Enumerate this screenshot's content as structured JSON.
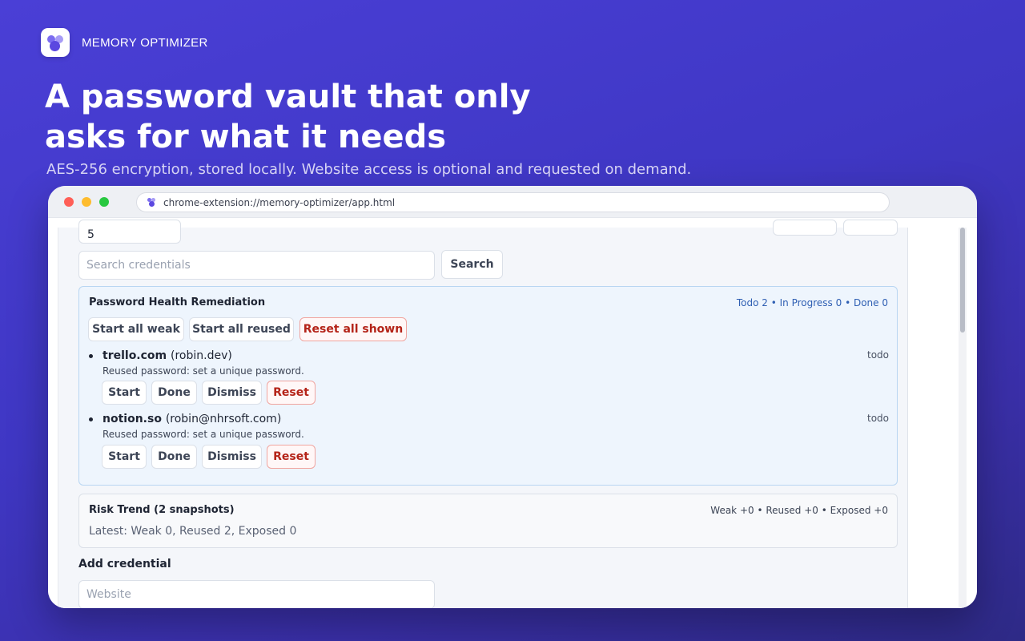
{
  "brand": {
    "name": "MEMORY OPTIMIZER",
    "logo_icon": "memory-optimizer-logo-icon"
  },
  "hero": {
    "headline_line1": "A password vault that only",
    "headline_line2": "asks for what it needs",
    "subline": "AES-256 encryption, stored locally. Website access is optional and requested on demand."
  },
  "browser": {
    "url": "chrome-extension://memory-optimizer/app.html",
    "traffic_lights": [
      "close",
      "minimize",
      "maximize"
    ]
  },
  "app": {
    "partial_field_value": "5",
    "search": {
      "placeholder": "Search credentials",
      "button_label": "Search"
    },
    "health": {
      "title": "Password Health Remediation",
      "stats": {
        "todo": "Todo 2",
        "in_progress": "In Progress 0",
        "done": "Done 0",
        "separator": "•"
      },
      "actions": {
        "start_weak": "Start all weak",
        "start_reused": "Start all reused",
        "reset_shown": "Reset all shown"
      },
      "items": [
        {
          "site": "trello.com",
          "user": "(robin.dev)",
          "note": "Reused password: set a unique password.",
          "status": "todo",
          "buttons": {
            "start": "Start",
            "done": "Done",
            "dismiss": "Dismiss",
            "reset": "Reset"
          }
        },
        {
          "site": "notion.so",
          "user": "(robin@nhrsoft.com)",
          "note": "Reused password: set a unique password.",
          "status": "todo",
          "buttons": {
            "start": "Start",
            "done": "Done",
            "dismiss": "Dismiss",
            "reset": "Reset"
          }
        }
      ]
    },
    "risk": {
      "title": "Risk Trend (2 snapshots)",
      "stats": "Weak +0 • Reused +0 • Exposed +0",
      "latest": "Latest: Weak 0, Reused 2, Exposed 0"
    },
    "add": {
      "title": "Add credential",
      "website_placeholder": "Website"
    }
  },
  "colors": {
    "accent": "#4a3fd6",
    "danger": "#b42318",
    "info": "#2f5fb3",
    "panel_bg": "#eef5fd"
  }
}
